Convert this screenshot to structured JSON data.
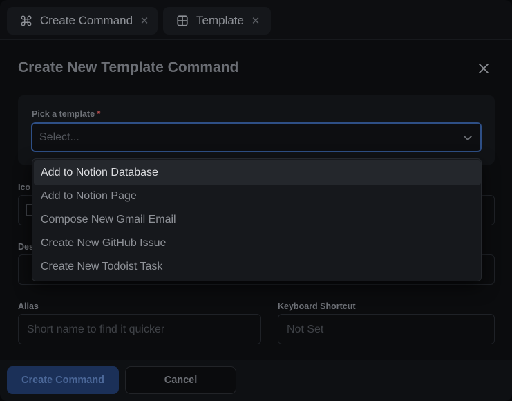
{
  "tabs": [
    {
      "label": "Create Command",
      "icon": "command-icon"
    },
    {
      "label": "Template",
      "icon": "template-icon"
    }
  ],
  "dialog": {
    "title": "Create New Template Command"
  },
  "template_field": {
    "label": "Pick a template",
    "required_marker": "*",
    "placeholder": "Select..."
  },
  "dropdown": {
    "options": [
      "Add to Notion Database",
      "Add to Notion Page",
      "Compose New Gmail Email",
      "Create New GitHub Issue",
      "Create New Todoist Task"
    ],
    "highlighted_index": 0
  },
  "fields": {
    "icon_label": "Ico",
    "description_label": "Des",
    "alias_label": "Alias",
    "alias_placeholder": "Short name to find it quicker",
    "shortcut_label": "Keyboard Shortcut",
    "shortcut_placeholder": "Not Set"
  },
  "footer": {
    "create_label": "Create Command",
    "cancel_label": "Cancel"
  },
  "colors": {
    "accent": "#2e4f86",
    "primary_button": "#1b3058",
    "required": "#c25050"
  }
}
